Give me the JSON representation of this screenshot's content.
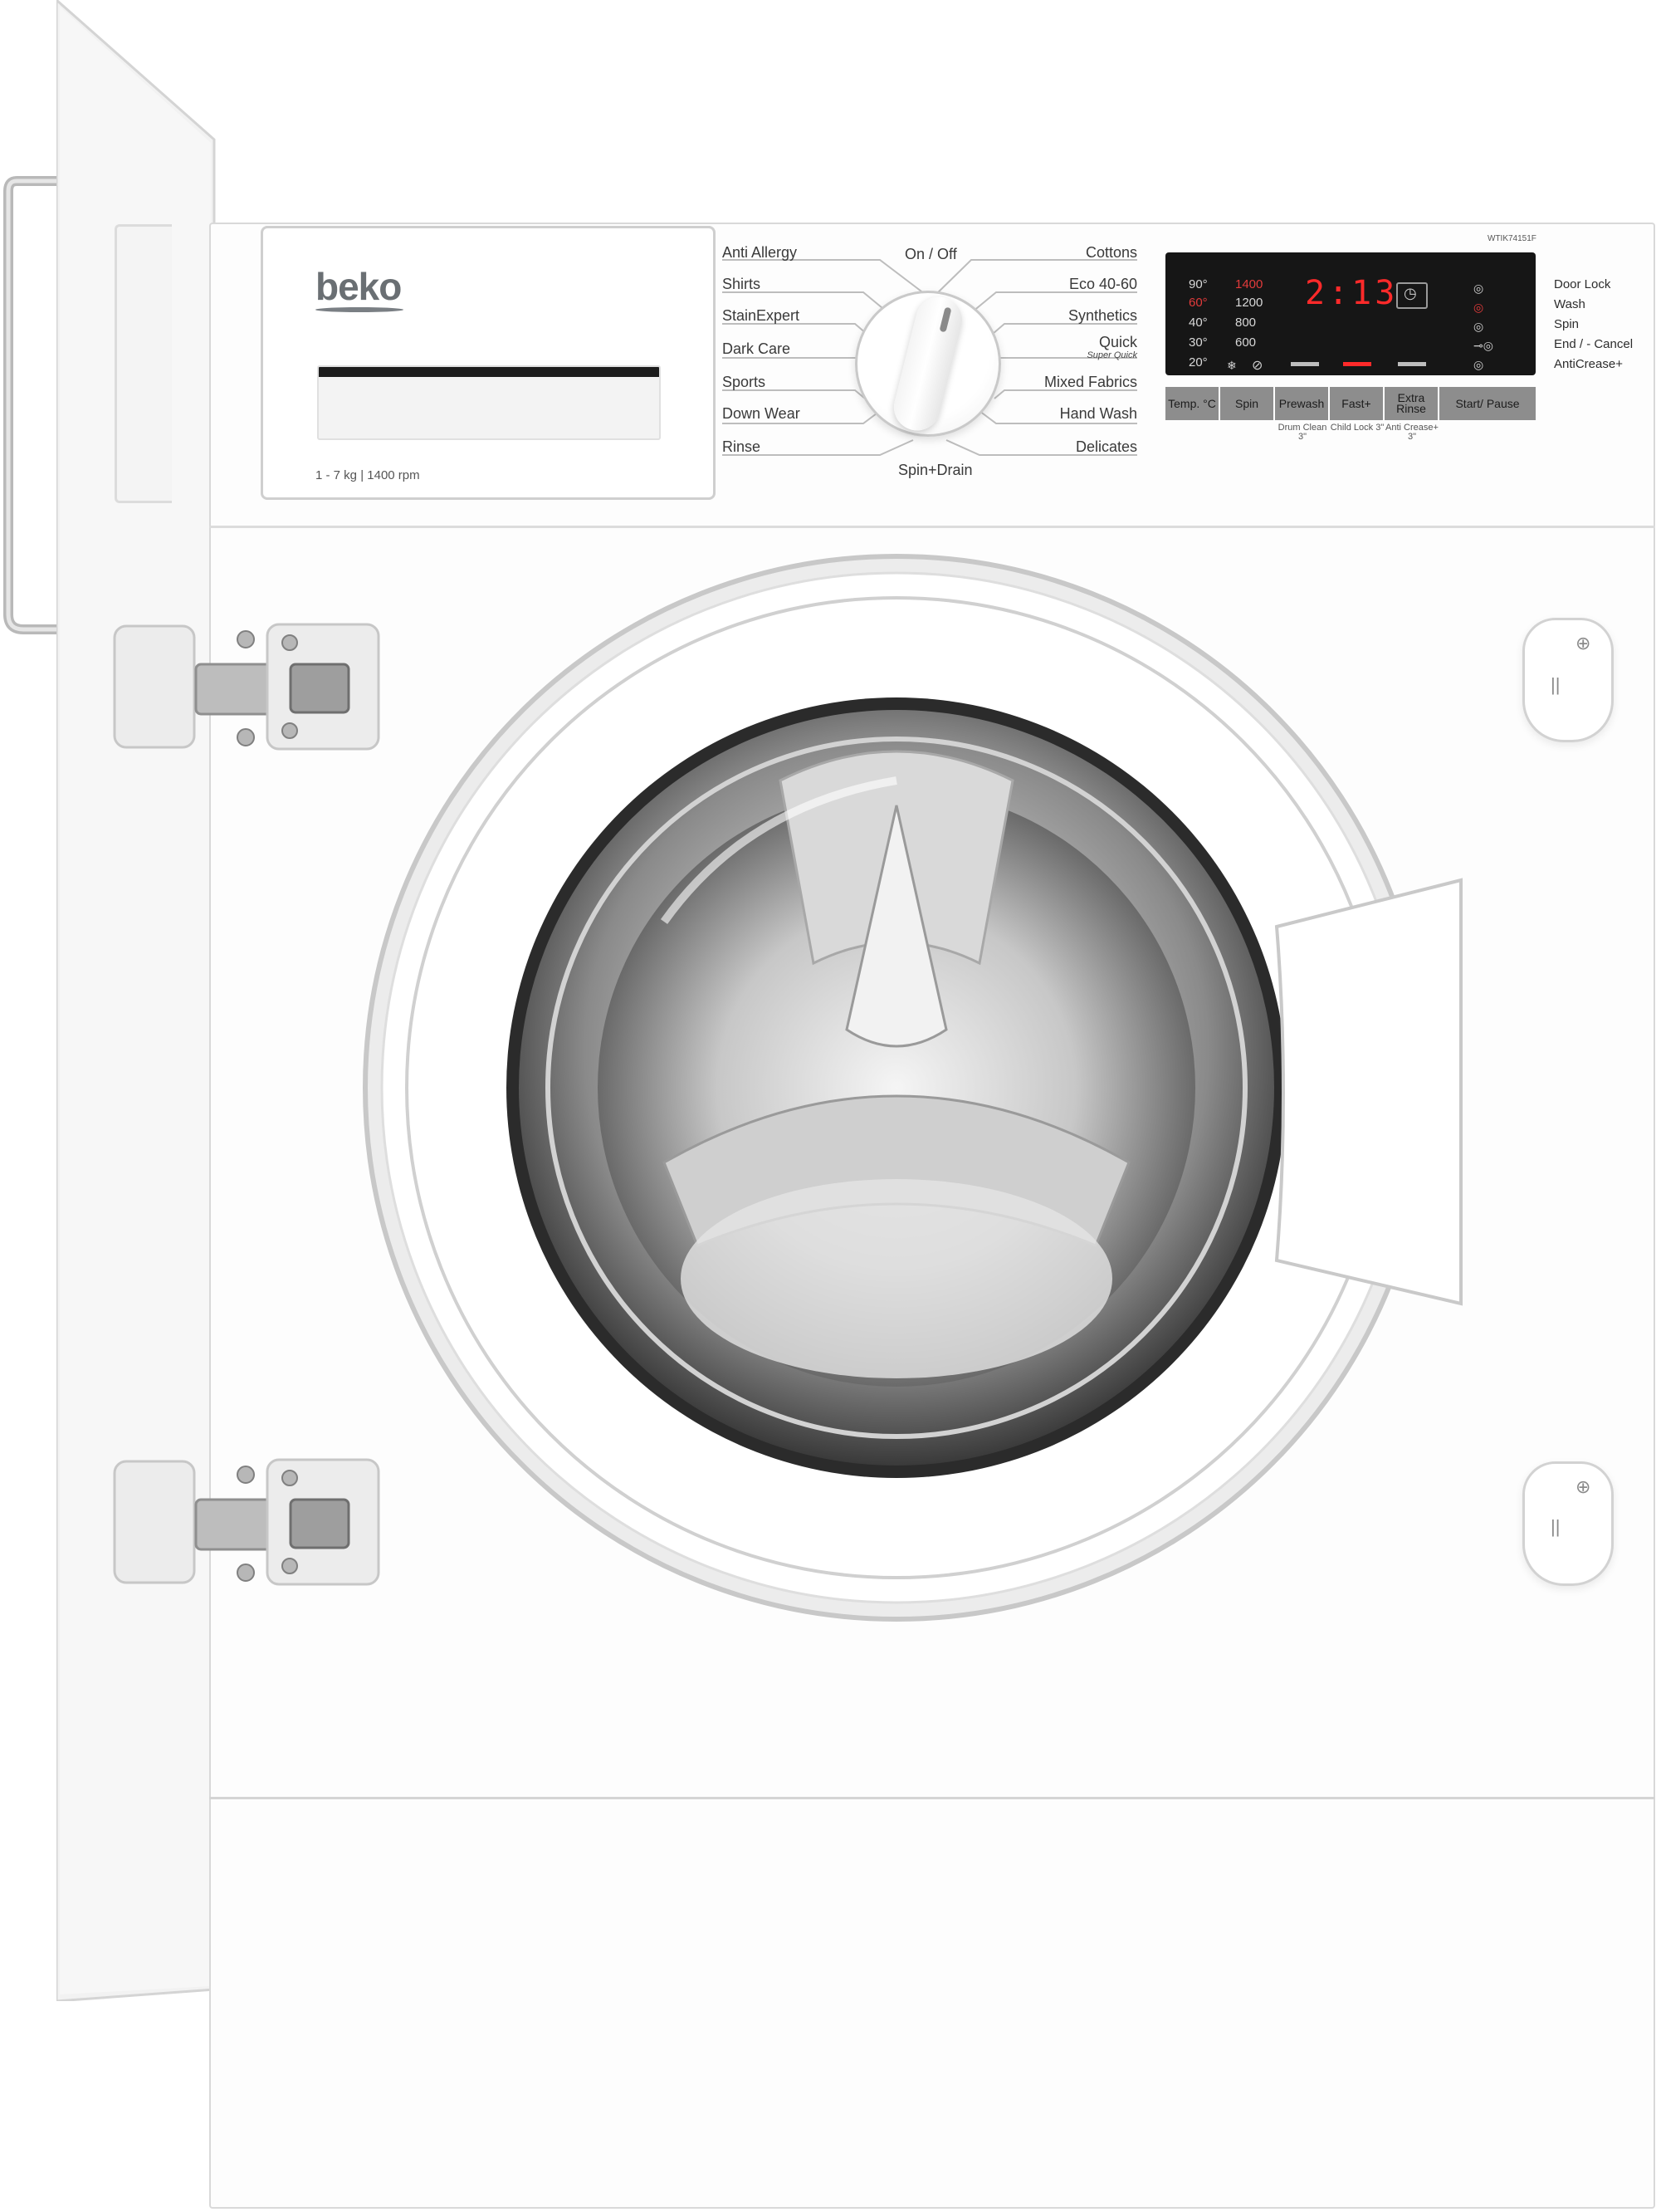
{
  "brand": "beko",
  "drawer": {
    "capacity": "1 - 7 kg | 1400 rpm"
  },
  "programs_left": [
    "Anti Allergy",
    "Shirts",
    "StainExpert",
    "Dark Care",
    "Sports",
    "Down Wear",
    "Rinse"
  ],
  "programs_right": [
    "Cottons",
    "Eco 40-60",
    "Synthetics",
    "Quick",
    "Mixed Fabrics",
    "Hand Wash",
    "Delicates"
  ],
  "quick_sub": "Super Quick",
  "dial_top": "On / Off",
  "dial_bottom": "Spin+Drain",
  "model": "WTIK74151F",
  "display": {
    "temps": [
      "90°",
      "60°",
      "40°",
      "30°",
      "20°"
    ],
    "speeds": [
      "1400",
      "1200",
      "800",
      "600"
    ],
    "time": "2:13"
  },
  "buttons": [
    "Temp. °C",
    "Spin",
    "Prewash",
    "Fast+",
    "Extra Rinse",
    "Start/ Pause"
  ],
  "button_subs": [
    "Drum Clean 3\"",
    "Child Lock 3\"",
    "Anti Crease+ 3\""
  ],
  "status": [
    "Door Lock",
    "Wash",
    "Spin",
    "End / - Cancel",
    "AntiCrease+"
  ],
  "colors": {
    "display_bg": "#161616",
    "display_red": "#ff2a2a",
    "button_grey": "#8d8d8d",
    "body_white": "#fdfdfd"
  }
}
